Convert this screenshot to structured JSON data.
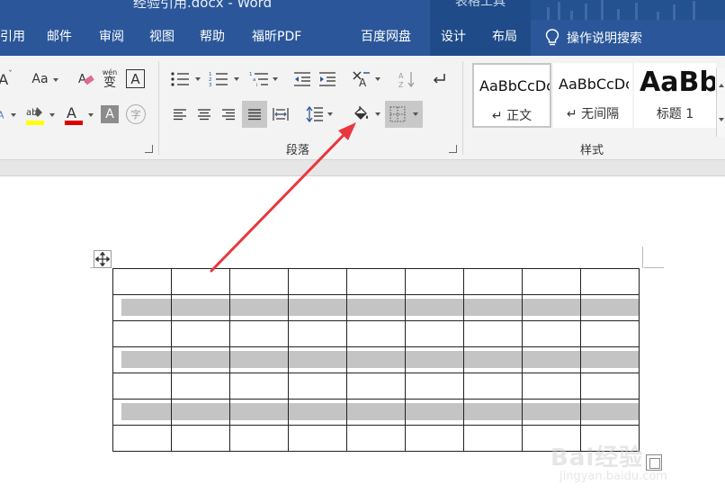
{
  "window": {
    "title": "经验引用.docx  -  Word",
    "context_tab_title": "表格工具"
  },
  "tabs": [
    {
      "label": "引用"
    },
    {
      "label": "邮件"
    },
    {
      "label": "审阅"
    },
    {
      "label": "视图"
    },
    {
      "label": "帮助"
    },
    {
      "label": "福昕PDF"
    },
    {
      "label": "百度网盘"
    },
    {
      "label": "设计"
    },
    {
      "label": "布局"
    }
  ],
  "tell_me": {
    "label": "操作说明搜索",
    "icon": "lightbulb-icon"
  },
  "ribbon": {
    "font_group": {
      "change_case_label": "Aa",
      "phonetic_label": "wén",
      "phonetic_char": "变",
      "char_border_label": "A",
      "highlight_color": "#ffff00",
      "font_color": "#e00000",
      "char_shading_label": "A",
      "enclose_char": "字"
    },
    "paragraph_group": {
      "label": "段落"
    },
    "styles_group": {
      "label": "样式",
      "styles": [
        {
          "sample": "AaBbCcDc",
          "name": "↵ 正文",
          "selected": true
        },
        {
          "sample": "AaBbCcDc",
          "name": "↵ 无间隔",
          "selected": false
        },
        {
          "sample": "AaBb",
          "name": "标题 1",
          "selected": false
        }
      ]
    }
  },
  "document": {
    "table": {
      "rows": 7,
      "cols": 9,
      "shaded_rows": [
        1,
        3,
        5
      ],
      "shade_color": "#c4c4c4"
    }
  },
  "colors": {
    "brand": "#2b579a",
    "annotation": "#e8383d"
  },
  "watermark": {
    "logo": "Bai经验",
    "url": "jingyan.baidu.com"
  }
}
